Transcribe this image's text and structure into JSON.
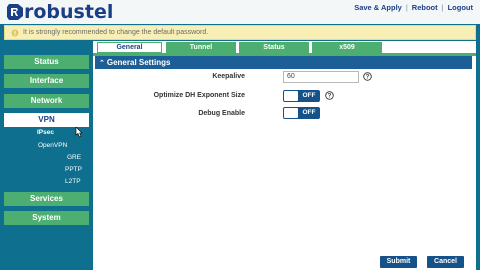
{
  "brand": {
    "name": "robustel",
    "color": "#1b3f86"
  },
  "header": {
    "links": [
      "Save & Apply",
      "Reboot",
      "Logout"
    ]
  },
  "warning": {
    "text": "It is strongly recommended to change the default password."
  },
  "sidebar": {
    "items": [
      {
        "label": "Status"
      },
      {
        "label": "Interface"
      },
      {
        "label": "Network"
      },
      {
        "label": "VPN",
        "active": true
      },
      {
        "label": "Services"
      },
      {
        "label": "System"
      }
    ],
    "vpn_subitems": [
      "IPsec",
      "OpenVPN",
      "GRE",
      "PPTP",
      "L2TP"
    ]
  },
  "tabs": [
    {
      "label": "General",
      "active": true
    },
    {
      "label": "Tunnel"
    },
    {
      "label": "Status"
    },
    {
      "label": "x509"
    }
  ],
  "section": {
    "title": "General Settings",
    "collapse_icon": "chevron-up-icon"
  },
  "fields": {
    "keepalive": {
      "label": "Keepalive",
      "value": "60"
    },
    "optimize_dh": {
      "label": "Optimize DH Exponent Size",
      "state": "OFF"
    },
    "debug": {
      "label": "Debug Enable",
      "state": "OFF"
    }
  },
  "buttons": {
    "submit": "Submit",
    "cancel": "Cancel"
  },
  "colors": {
    "accent_green": "#4caf71",
    "nav_blue": "#16528a",
    "background": "#0f6f8f"
  }
}
